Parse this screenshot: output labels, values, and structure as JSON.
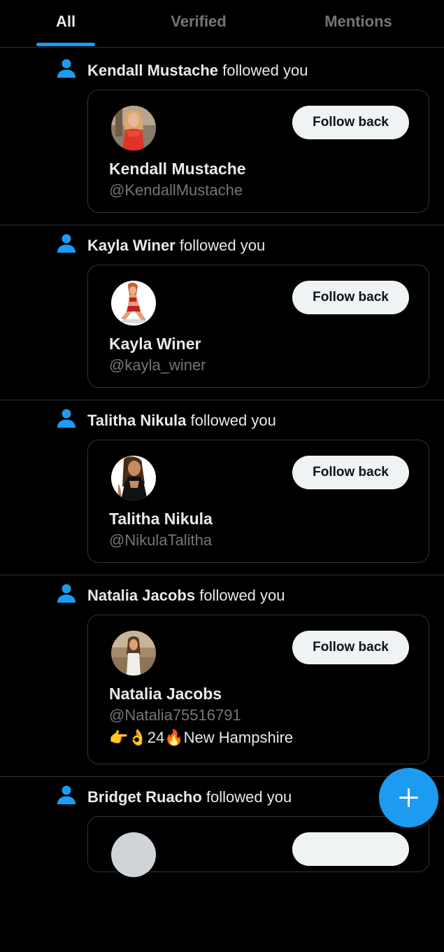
{
  "tabs": [
    {
      "label": "All",
      "active": true
    },
    {
      "label": "Verified",
      "active": false
    },
    {
      "label": "Mentions",
      "active": false
    }
  ],
  "notifications": [
    {
      "icon": "person-icon",
      "name": "Kendall Mustache",
      "action": "followed you",
      "display_name": "Kendall Mustache",
      "handle": "@KendallMustache",
      "button": "Follow back"
    },
    {
      "icon": "person-icon",
      "name": "Kayla Winer",
      "action": "followed you",
      "display_name": "Kayla Winer",
      "handle": "@kayla_winer",
      "button": "Follow back"
    },
    {
      "icon": "person-icon",
      "name": "Talitha Nikula",
      "action": "followed you",
      "display_name": "Talitha Nikula",
      "handle": "@NikulaTalitha",
      "button": "Follow back"
    },
    {
      "icon": "person-icon",
      "name": "Natalia Jacobs",
      "action": "followed you",
      "display_name": "Natalia Jacobs",
      "handle": "@Natalia75516791",
      "bio": "👉👌24🔥New Hampshire",
      "button": "Follow back"
    },
    {
      "icon": "person-icon",
      "name": "Bridget Ruacho",
      "action": "followed you"
    }
  ],
  "fab": {
    "icon": "plus-icon"
  },
  "colors": {
    "accent": "#1d9bf0",
    "background": "#000000",
    "text_primary": "#e7e9ea",
    "text_secondary": "#71767b",
    "border": "#2f3336",
    "button_bg": "#eff3f4"
  }
}
